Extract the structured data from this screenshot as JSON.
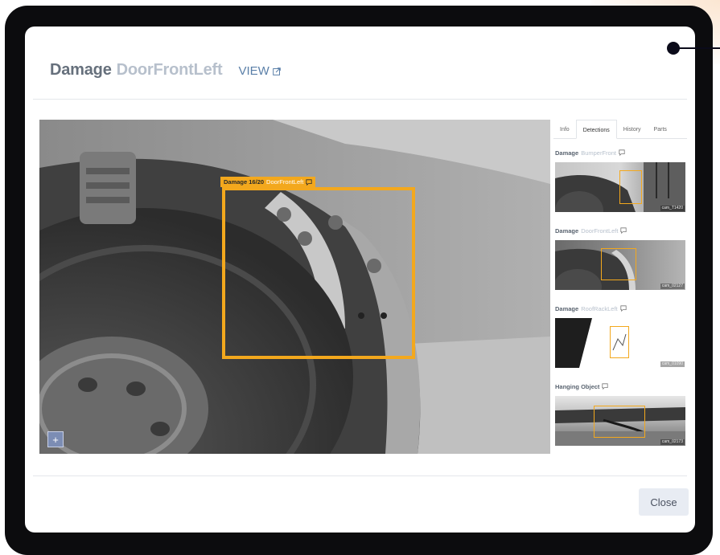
{
  "modal": {
    "title_main": "Damage",
    "title_part": "DoorFrontLeft",
    "view_label": "VIEW",
    "close_label": "Close"
  },
  "viewer": {
    "bbox_label_main": "Damage 16/20",
    "bbox_label_part": "DoorFrontLeft",
    "zoom_label": "+"
  },
  "side": {
    "tabs": [
      "Info",
      "Detections",
      "History",
      "Parts"
    ],
    "active_tab": "Detections",
    "detections": [
      {
        "main": "Damage",
        "part": "BumperFront",
        "tag": "cam_T1420"
      },
      {
        "main": "Damage",
        "part": "DoorFrontLeft",
        "tag": "cam_02127"
      },
      {
        "main": "Damage",
        "part": "RoofRackLeft",
        "tag": "cam_01090"
      },
      {
        "main": "Hanging Object",
        "part": "",
        "tag": "cam_02173"
      }
    ]
  },
  "colors": {
    "accent": "#f3a81d",
    "title": "#66707c",
    "subtitle": "#b7c0cc",
    "link": "#5a7fa8",
    "button_bg": "#e8ecf3"
  },
  "icons": [
    "external-link-icon",
    "comment-icon",
    "plus-icon"
  ]
}
